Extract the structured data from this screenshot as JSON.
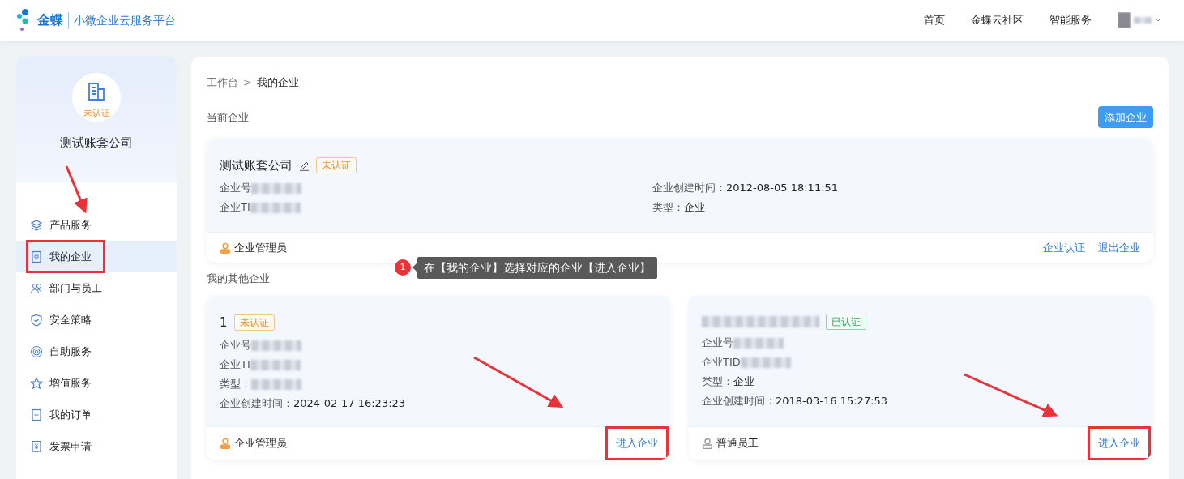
{
  "header": {
    "logo": "金蝶",
    "platform": "小微企业云服务平台",
    "nav": [
      {
        "label": "首页"
      },
      {
        "label": "金蝶云社区"
      },
      {
        "label": "智能服务"
      }
    ]
  },
  "sidebar": {
    "status": "未认证",
    "company": "测试账套公司",
    "items": [
      {
        "label": "产品服务",
        "selected": false,
        "highlighted": false
      },
      {
        "label": "我的企业",
        "selected": true,
        "highlighted": true
      },
      {
        "label": "部门与员工",
        "selected": false,
        "highlighted": false
      },
      {
        "label": "安全策略",
        "selected": false,
        "highlighted": false
      },
      {
        "label": "自助服务",
        "selected": false,
        "highlighted": false
      },
      {
        "label": "增值服务",
        "selected": false,
        "highlighted": false
      },
      {
        "label": "我的订单",
        "selected": false,
        "highlighted": false
      },
      {
        "label": "发票申请",
        "selected": false,
        "highlighted": false
      }
    ]
  },
  "breadcrumb": {
    "items": [
      "工作台",
      "我的企业"
    ],
    "separator": ">"
  },
  "current": {
    "heading": "当前企业",
    "add_button": "添加企业",
    "company": {
      "name": "测试账套公司",
      "badge": "未认证",
      "verified": false,
      "left_fields": [
        {
          "label": "企业号",
          "redacted": true
        },
        {
          "label": "企业TI",
          "redacted": true
        }
      ],
      "right_fields": [
        {
          "label": "企业创建时间：",
          "value": "2012-08-05 18:11:51"
        },
        {
          "label": "类型：",
          "value": "企业"
        }
      ],
      "role": "企业管理员",
      "admin": true,
      "links": [
        "企业认证",
        "退出企业"
      ]
    }
  },
  "tip": {
    "step": "1",
    "text": "在【我的企业】选择对应的企业【进入企业】"
  },
  "others": {
    "heading": "我的其他企业",
    "companies": [
      {
        "name": "1",
        "badge": "未认证",
        "verified": false,
        "fields": [
          {
            "label": "企业号",
            "redacted": true
          },
          {
            "label": "企业TI",
            "redacted": true
          },
          {
            "label": "类型：",
            "redacted": true
          },
          {
            "label": "企业创建时间：",
            "value": "2024-02-17 16:23:23"
          }
        ],
        "role": "企业管理员",
        "admin": true,
        "link": "进入企业",
        "highlighted": true
      },
      {
        "name_redacted": true,
        "badge": "已认证",
        "verified": true,
        "fields": [
          {
            "label": "企业号",
            "redacted": true
          },
          {
            "label": "企业TID",
            "redacted": true
          },
          {
            "label": "类型：",
            "value": "企业"
          },
          {
            "label": "企业创建时间：",
            "value": "2018-03-16 15:27:53"
          }
        ],
        "role": "普通员工",
        "admin": false,
        "link": "进入企业",
        "highlighted": true
      }
    ]
  }
}
